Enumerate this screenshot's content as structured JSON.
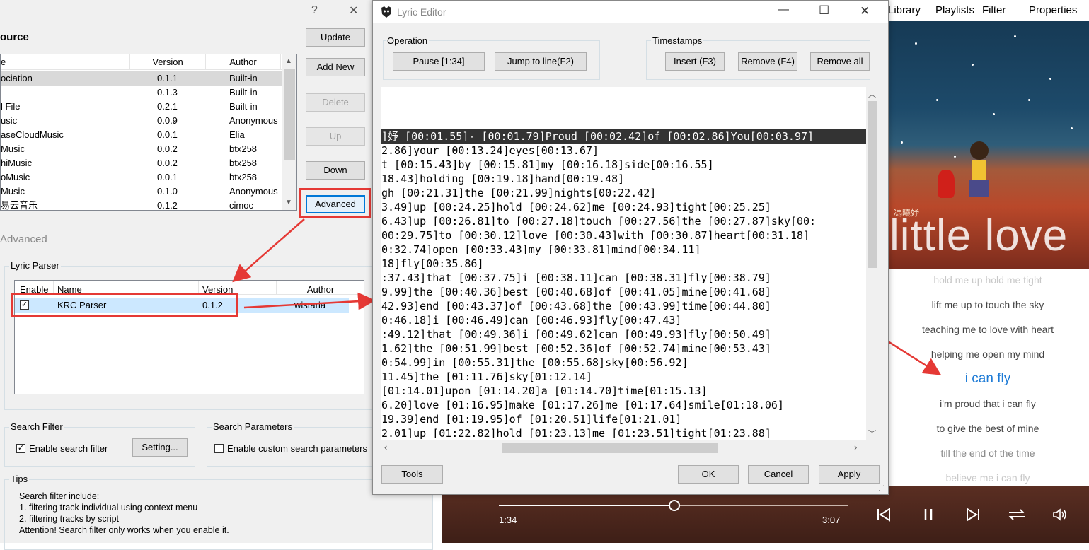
{
  "bg_dialog": {
    "help_glyph": "?",
    "close_glyph": "✕",
    "source_title": "ource",
    "source_columns": [
      "e",
      "Version",
      "Author"
    ],
    "source_rows": [
      {
        "name": "ociation",
        "version": "0.1.1",
        "author": "Built-in"
      },
      {
        "name": "",
        "version": "0.1.3",
        "author": "Built-in"
      },
      {
        "name": "l File",
        "version": "0.2.1",
        "author": "Built-in"
      },
      {
        "name": "usic",
        "version": "0.0.9",
        "author": "Anonymous"
      },
      {
        "name": "aseCloudMusic",
        "version": "0.0.1",
        "author": "Elia"
      },
      {
        "name": "Music",
        "version": "0.0.2",
        "author": "btx258"
      },
      {
        "name": "hiMusic",
        "version": "0.0.2",
        "author": "btx258"
      },
      {
        "name": "oMusic",
        "version": "0.0.1",
        "author": "btx258"
      },
      {
        "name": "Music",
        "version": "0.1.0",
        "author": "Anonymous"
      },
      {
        "name": "易云音乐",
        "version": "0.1.2",
        "author": "cimoc"
      }
    ],
    "buttons": {
      "update": "Update",
      "add_new": "Add New",
      "delete": "Delete",
      "up": "Up",
      "down": "Down",
      "advanced": "Advanced"
    },
    "advanced_title": "Advanced",
    "lyric_parser_title": "Lyric Parser",
    "parser_columns": [
      "Enable",
      "Name",
      "Version",
      "Author"
    ],
    "parser_row": {
      "enabled": "✓",
      "name": "KRC Parser",
      "version": "0.1.2",
      "author": "wistaria"
    },
    "search_filter_title": "Search Filter",
    "enable_search_filter": "Enable search filter",
    "setting_button": "Setting...",
    "search_params_title": "Search Parameters",
    "enable_custom_params": "Enable custom search parameters",
    "tips_title": "Tips",
    "tips_lines": [
      "Search filter include:",
      "1. filtering track individual using context menu",
      "2. filtering tracks by script",
      "Attention! Search filter only works when you enable it."
    ]
  },
  "editor": {
    "title": "Lyric Editor",
    "min_glyph": "—",
    "max_glyph": "☐",
    "close_glyph": "✕",
    "operation_title": "Operation",
    "pause_button": "Pause  [1:34]",
    "jump_button": "Jump to line(F2)",
    "timestamps_title": "Timestamps",
    "insert_button": "Insert (F3)",
    "remove_button": "Remove (F4)",
    "remove_all_button": "Remove all",
    "lyric_lines": [
      "",
      "",
      "",
      "]妤 [00:01.55]- [00:01.79]Proud [00:02.42]of [00:02.86]You[00:03.97]",
      "2.86]your [00:13.24]eyes[00:13.67]",
      "t [00:15.43]by [00:15.81]my [00:16.18]side[00:16.55]",
      "18.43]holding [00:19.18]hand[00:19.48]",
      "gh [00:21.31]the [00:21.99]nights[00:22.42]",
      "3.49]up [00:24.25]hold [00:24.62]me [00:24.93]tight[00:25.25]",
      "6.43]up [00:26.81]to [00:27.18]touch [00:27.56]the [00:27.87]sky[00:",
      "00:29.75]to [00:30.12]love [00:30.43]with [00:30.87]heart[00:31.18]",
      "0:32.74]open [00:33.43]my [00:33.81]mind[00:34.11]",
      "18]fly[00:35.86]",
      ":37.43]that [00:37.75]i [00:38.11]can [00:38.31]fly[00:38.79]",
      "9.99]the [00:40.36]best [00:40.68]of [00:41.05]mine[00:41.68]",
      "42.93]end [00:43.37]of [00:43.68]the [00:43.99]time[00:44.80]",
      "0:46.18]i [00:46.49]can [00:46.93]fly[00:47.43]",
      ":49.12]that [00:49.36]i [00:49.62]can [00:49.93]fly[00:50.49]",
      "1.62]the [00:51.99]best [00:52.36]of [00:52.74]mine[00:53.43]",
      "0:54.99]in [00:55.31]the [00:55.68]sky[00:56.92]",
      "11.45]the [01:11.76]sky[01:12.14]",
      "[01:14.01]upon [01:14.20]a [01:14.70]time[01:15.13]",
      "6.20]love [01:16.95]make [01:17.26]me [01:17.64]smile[01:18.06]",
      "19.39]end [01:19.95]of [01:20.51]life[01:21.01]",
      "2.01]up [01:22.82]hold [01:23.13]me [01:23.51]tight[01:23.88]"
    ],
    "tools_button": "Tools",
    "ok_button": "OK",
    "cancel_button": "Cancel",
    "apply_button": "Apply"
  },
  "player": {
    "tabs": [
      "Library",
      "Playlists",
      "Filter",
      "Properties"
    ],
    "art_artist": "馮曦妤",
    "art_title": "little love",
    "lyrics": [
      {
        "text": "hold me up hold me tight",
        "state": "past"
      },
      {
        "text": "lift me up to touch the sky",
        "state": "near"
      },
      {
        "text": "teaching me to love with heart",
        "state": "near"
      },
      {
        "text": "helping me open my mind",
        "state": "near"
      },
      {
        "text": "i can fly",
        "state": "current"
      },
      {
        "text": "i'm proud that i can fly",
        "state": "near"
      },
      {
        "text": "to give the best of mine",
        "state": "near"
      },
      {
        "text": "till the end of the time",
        "state": "far"
      },
      {
        "text": "believe me i can fly",
        "state": "past"
      }
    ],
    "elapsed": "1:34",
    "total": "3:07",
    "progress": 0.503,
    "current_color": "#1e7bd6"
  }
}
